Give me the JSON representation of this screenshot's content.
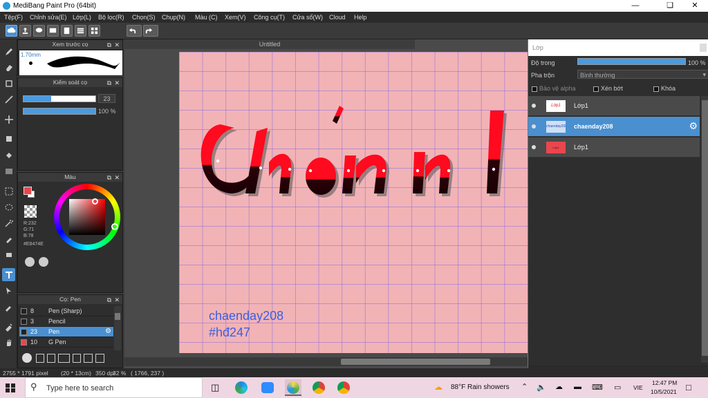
{
  "window": {
    "title": "MediBang Paint Pro (64bit)"
  },
  "menu": [
    "Tệp(F)",
    "Chỉnh sửa(E)",
    "Lớp(L)",
    "Bộ lọc(R)",
    "Chọn(S)",
    "Chụp(N)",
    "Màu (C)",
    "Xem(V)",
    "Công cụ(T)",
    "Cửa sổ(W)",
    "Cloud",
    "Help"
  ],
  "brush_preview": {
    "title": "Xem trước cọ",
    "size": "1.70mm"
  },
  "brush_control": {
    "title": "Kiểm soát cọ",
    "size_value": "23",
    "size_fill": 0.38,
    "opacity_value": "100 %",
    "opacity_fill": 1.0
  },
  "color_panel": {
    "title": "Màu",
    "r": "R:232",
    "g": "G:71",
    "b": "B:78",
    "hex": "#E8474E",
    "current_color": "#E8474E"
  },
  "brush_list": {
    "title": "Cọ: Pen",
    "items": [
      {
        "num": "8",
        "name": "Pen (Sharp)",
        "color": "#222222",
        "selected": false
      },
      {
        "num": "3",
        "name": "Pencil",
        "color": "#222222",
        "selected": false
      },
      {
        "num": "23",
        "name": "Pen",
        "color": "#222222",
        "selected": true
      },
      {
        "num": "10",
        "name": "G Pen",
        "color": "#e8474e",
        "selected": false
      }
    ]
  },
  "document": {
    "tab_title": "Untitled"
  },
  "artwork": {
    "text1": "chaenday208",
    "text2": "#hđ247"
  },
  "layers": {
    "title": "Lớp",
    "opacity_label": "Độ trong",
    "opacity_value": "100 %",
    "blend_label": "Pha trộn",
    "blend_value": "Bình thường",
    "protect_alpha": "Bảo vệ alpha",
    "clipping": "Xén bớt",
    "lock": "Khóa",
    "items": [
      {
        "name": "Lớp1",
        "selected": false
      },
      {
        "name": "chaenday208",
        "selected": true
      },
      {
        "name": "Lớp1",
        "selected": false
      }
    ]
  },
  "status": {
    "dims": "2755 * 1791 pixel",
    "cm": "(20 * 13cm)",
    "dpi": "350 dpi",
    "zoom": "32 %",
    "coords": "( 1766, 237 )"
  },
  "taskbar": {
    "search_placeholder": "Type here to search",
    "weather": "88°F  Rain showers",
    "lang": "VIE",
    "time": "12:47 PM",
    "date": "10/5/2021"
  }
}
